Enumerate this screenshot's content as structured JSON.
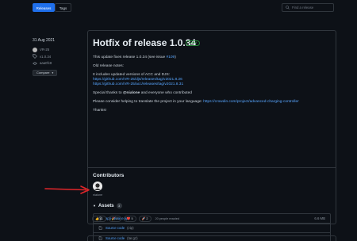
{
  "tabs": {
    "releases": "Releases",
    "tags": "Tags"
  },
  "search": {
    "placeholder": "Find a release"
  },
  "sidebar": {
    "date": "31 Aug 2021",
    "author": "VR-25",
    "tag": "v1.0.34",
    "commit": "aaa0fc8",
    "compare_label": "Compare"
  },
  "release": {
    "title": "Hotfix of release 1.0.34",
    "badge": "Latest",
    "intro_text": "This update fixes release 1.0.34 (see issue ",
    "issue_link": "#109",
    "intro_end": ")",
    "old_notes": "Old release notes:",
    "includes": "It includes updated versions of ACC and DJS:",
    "link1": "https://github.com/VR-25/djs/releases/tag/v2021.8.26",
    "link2": "https://github.com/VR-25/acc/releases/tag/v2021.8.31",
    "thanks_pre": "Special thanks to ",
    "thanks_user": "@nialone",
    "thanks_post": " and everyone who contributed",
    "translate_text": "Please consider helping to translate the project in your language: ",
    "translate_link": "https://crowdin.com/project/advanced-charging-controller",
    "thanks_end": "Thanks!"
  },
  "contributors": {
    "title": "Contributors",
    "name": "nialone"
  },
  "assets": {
    "title": "Assets",
    "count": "3",
    "items": [
      {
        "name": "app-release.apk",
        "sub": "",
        "size": "6.6 MB"
      },
      {
        "name": "Source code",
        "sub": "(zip)",
        "size": ""
      },
      {
        "name": "Source code",
        "sub": "(tar.gz)",
        "size": ""
      }
    ]
  },
  "reactions": {
    "items": [
      {
        "emoji": "👍",
        "count": "11"
      },
      {
        "emoji": "🎉",
        "count": "2"
      },
      {
        "emoji": "❤️",
        "count": "5"
      },
      {
        "emoji": "🚀",
        "count": "2"
      }
    ],
    "summary": "20 people reacted"
  },
  "colors": {
    "accent": "#1f6feb",
    "link": "#58a6ff",
    "latest": "#3fb950",
    "annotation_arrow": "#e0262a"
  },
  "icons": [
    "search-icon",
    "avatar",
    "tag-icon",
    "commit-icon",
    "package-icon",
    "file-zip-icon",
    "annotation-arrow"
  ]
}
